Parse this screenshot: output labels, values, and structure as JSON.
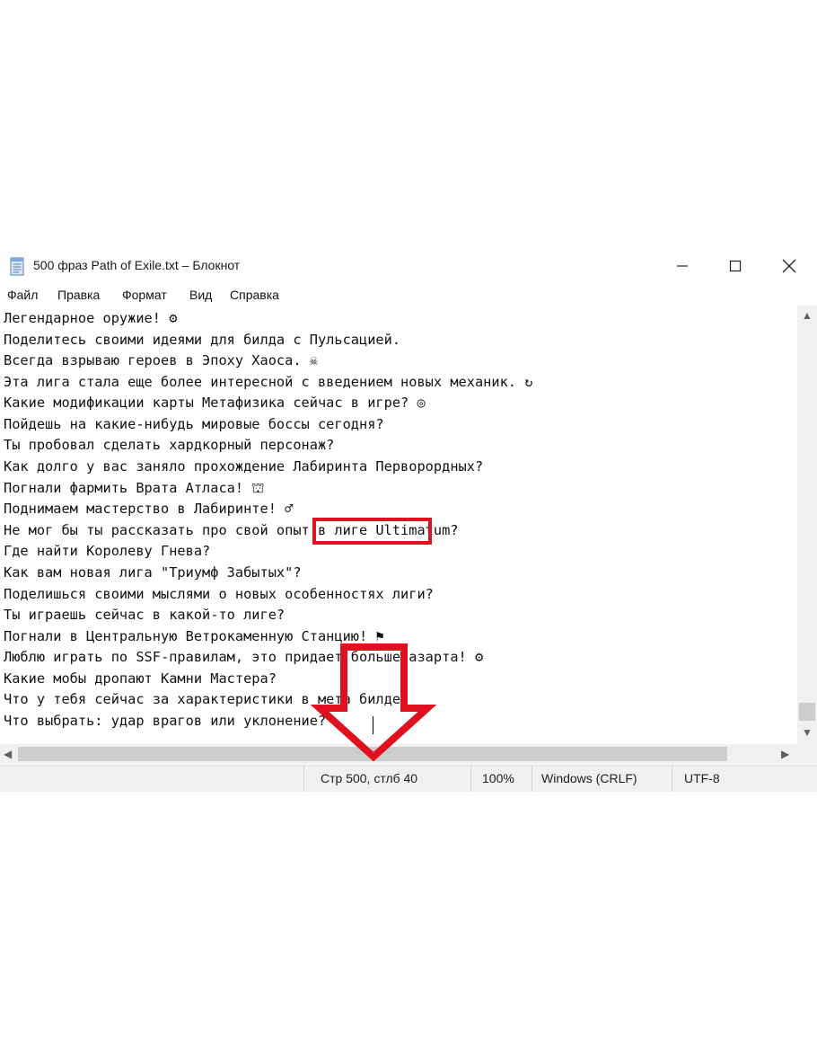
{
  "window": {
    "title": "500 фраз Path of Exile.txt – Блокнот",
    "icon": "notepad-icon"
  },
  "menu": [
    "Файл",
    "Правка",
    "Формат",
    "Вид",
    "Справка"
  ],
  "lines": [
    "Легендарное оружие! ⚙",
    "Поделитесь своими идеями для билда с Пульсацией.",
    "Всегда взрываю героев в Эпоху Хаоса. ☠",
    "Эта лига стала еще более интересной с введением новых механик. ↻",
    "Какие модификации карты Метафизика сейчас в игре? ◎",
    "Пойдешь на какие-нибудь мировые боссы сегодня?",
    "Ты пробовал сделать хардкорный персонаж?",
    "Как долго у вас заняло прохождение Лабиринта Перворордных?",
    "Погнали фармить Врата Атласа! ⛫",
    "Поднимаем мастерство в Лабиринте! ♂",
    "Не мог бы ты рассказать про свой опыт в лиге Ultimatum?",
    "Где найти Королеву Гнева?",
    "Как вам новая лига \"Триумф Забытых\"?",
    "Поделишься своими мыслями о новых особенностях лиги?",
    "Ты играешь сейчас в какой-то лиге?",
    "Погнали в Центральную Ветрокаменную Станцию! ⚑",
    "Люблю играть по SSF-правилам, это придает больше азарта! ⚙",
    "Какие мобы дропают Камни Мастера?",
    "Что у тебя сейчас за характеристики в мета билде?",
    "Что выбрать: удар врагов или уклонение?"
  ],
  "status": {
    "position": "Стр 500, стлб 40",
    "zoom": "100%",
    "line_endings": "Windows (CRLF)",
    "encoding": "UTF-8"
  },
  "colors": {
    "highlight": "#e0101e"
  }
}
